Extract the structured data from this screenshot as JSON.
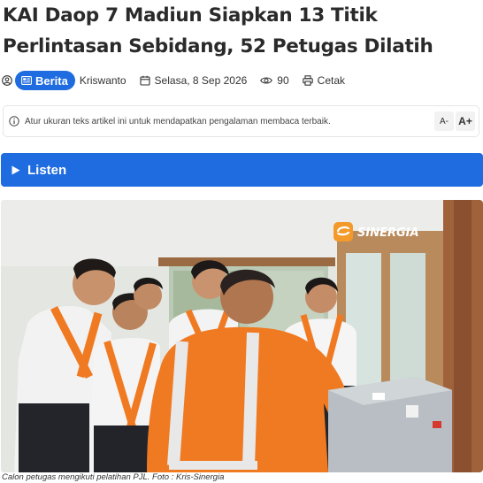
{
  "article": {
    "title": "KAI Daop 7 Madiun Siapkan 13 Titik Perlintasan Sebidang, 52 Petugas Dilatih",
    "category": "Berita",
    "author": "Kriswanto",
    "date": "Selasa, 8 Sep 2026",
    "views": "90",
    "print_label": "Cetak"
  },
  "notice": {
    "text": "Atur ukuran teks artikel ini untuk mendapatkan pengalaman membaca terbaik.",
    "decrease_label": "A-",
    "increase_label": "A+"
  },
  "listen": {
    "label": "Listen"
  },
  "photo": {
    "watermark": "SINERGIA",
    "caption": "Calon petugas mengikuti pelatihan PJL. Foto : Kris-Sinergia"
  },
  "colors": {
    "accent": "#1e6ce0",
    "vest": "#f07a22",
    "watermark": "#f39a2b"
  },
  "icons": [
    "user-icon",
    "newspaper-icon",
    "calendar-icon",
    "eye-icon",
    "printer-icon",
    "info-icon",
    "play-icon",
    "sinergia-logo-icon"
  ]
}
